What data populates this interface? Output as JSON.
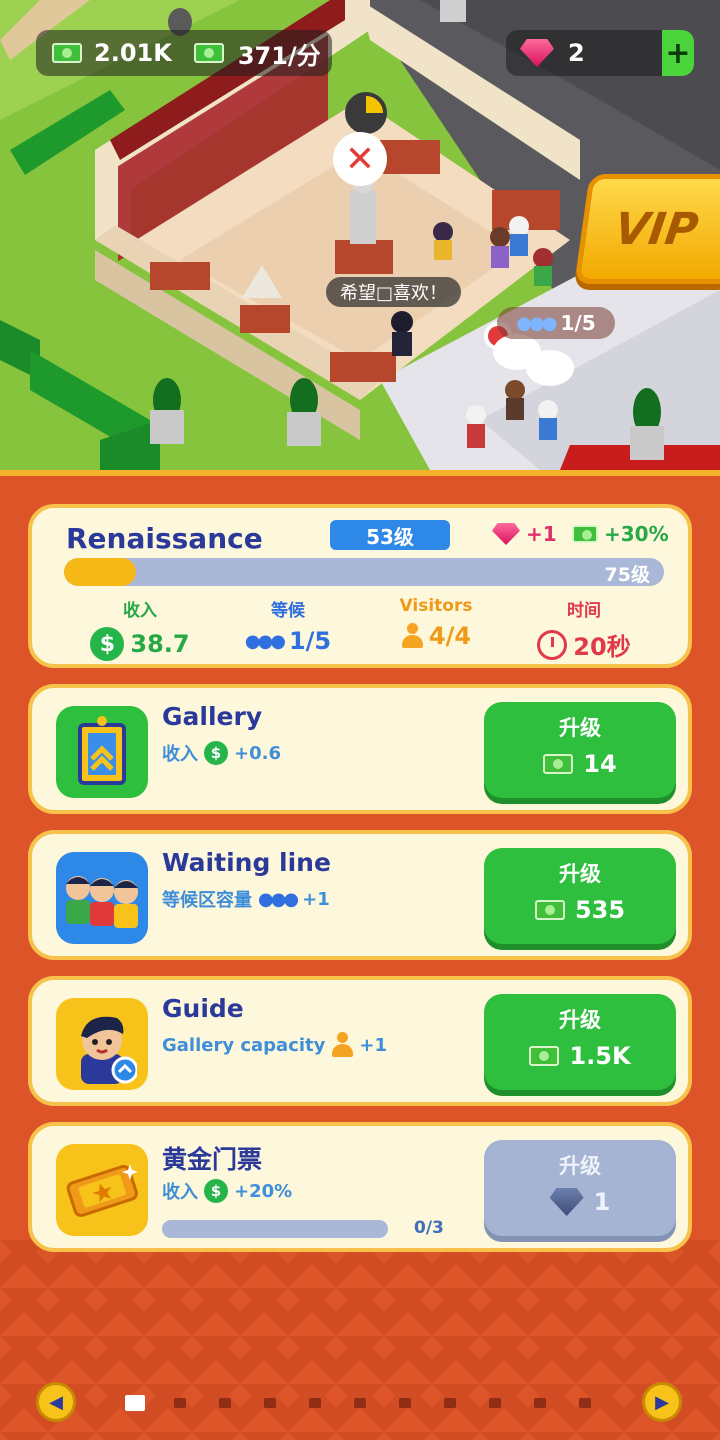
{
  "hud": {
    "cash": "2.01K",
    "income_rate": "371/分",
    "gems": "2",
    "add_label": "+"
  },
  "scene": {
    "speech_text": "希望□喜欢！",
    "queue_badge": "1/5",
    "vip_label": "VIP",
    "close_glyph": "✕"
  },
  "room": {
    "name": "Renaissance",
    "level": "53级",
    "gem_bonus": "+1",
    "cash_bonus": "+30%",
    "progress_label": "75级",
    "progress_fraction": 0.12,
    "stats": [
      {
        "label": "收入",
        "value": "38.7",
        "color": "#26a844"
      },
      {
        "label": "等候",
        "value": "1/5",
        "color": "#2f6fe0"
      },
      {
        "label": "Visitors",
        "value": "4/4",
        "color": "#f09a1a"
      },
      {
        "label": "时间",
        "value": "20秒",
        "color": "#e03a4a"
      }
    ]
  },
  "upgrades": [
    {
      "title": "Gallery",
      "desc_prefix": "收入",
      "desc_value": "+0.6",
      "button_label": "升级",
      "cost": "14",
      "icon": "gallery-frame-icon"
    },
    {
      "title": "Waiting line",
      "desc_prefix": "等候区容量",
      "desc_value": "+1",
      "button_label": "升级",
      "cost": "535",
      "icon": "waiting-people-icon"
    },
    {
      "title": "Guide",
      "desc_prefix": "Gallery capacity",
      "desc_value": "+1",
      "button_label": "升级",
      "cost": "1.5K",
      "icon": "guide-avatar-icon"
    },
    {
      "title": "黄金门票",
      "desc_prefix": "收入",
      "desc_value": "+20%",
      "button_label": "升级",
      "cost": "1",
      "progress": "0/3",
      "icon": "golden-ticket-icon"
    }
  ],
  "pager": {
    "prev": "◀",
    "next": "▶",
    "page_count": 11,
    "active_index": 0
  },
  "colors": {
    "panel_bg": "#dc5428",
    "card_bg": "#fdf7dc",
    "card_border": "#f7c24a",
    "button_green": "#2fbf3e",
    "button_disabled": "#a4b4d2",
    "title_blue": "#2b3a9a"
  }
}
